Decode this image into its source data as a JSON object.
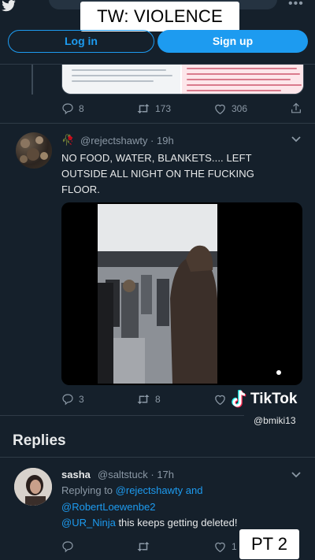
{
  "overlay": {
    "top_label": "TW: VIOLENCE",
    "bottom_label": "PT 2"
  },
  "auth": {
    "login_label": "Log in",
    "signup_label": "Sign up"
  },
  "prev_tweet": {
    "replies": "8",
    "retweets": "173",
    "likes": "306"
  },
  "tweet": {
    "emoji": "🥀",
    "handle_time": "@rejectshawty · 19h",
    "text_lines": [
      "NO FOOD, WATER, BLANKETS.... LEFT",
      "OUTSIDE ALL NIGHT ON THE FUCKING",
      "FLOOR."
    ],
    "replies": "3",
    "retweets": "8"
  },
  "watermark": {
    "brand": "TikTok",
    "user": "@bmiki13"
  },
  "replies_section": {
    "title": "Replies"
  },
  "reply": {
    "name": "sasha",
    "handle_time": "@saltstuck · 17h",
    "replying_prefix": "Replying to",
    "replying_user1": "@rejectshawty and",
    "replying_user2": "@RobertLoewenbe2",
    "mention": "@UR_Ninja",
    "text": " this keeps getting deleted!",
    "likes": "1"
  },
  "colors": {
    "background": "#15202b",
    "accent": "#1d9bf0",
    "muted": "#8b98a5"
  }
}
